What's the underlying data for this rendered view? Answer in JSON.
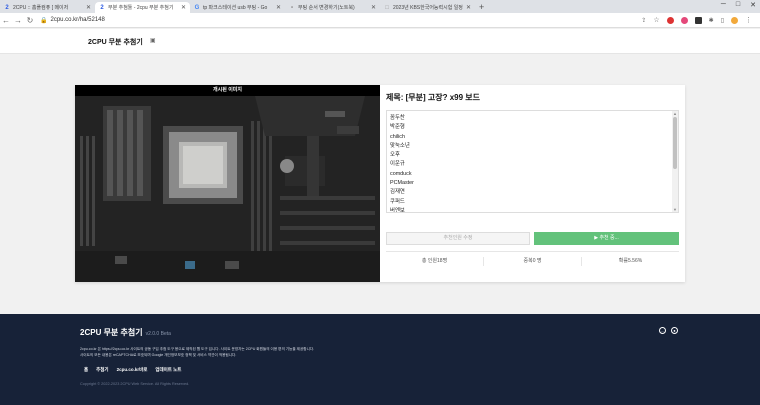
{
  "browser": {
    "tabs": [
      {
        "label": "2CPU :: 홈플컴퓨 [ 메이저",
        "favicon": "2",
        "favicon_color": "#2d5be3"
      },
      {
        "label": "무분 추첨툴 - 2cpu 무분 추첨기",
        "favicon": "2",
        "favicon_color": "#2d5be3"
      },
      {
        "label": "tp 파크스테이션 usb 부팅 - Go",
        "favicon": "G",
        "favicon_color": "#4285f4"
      },
      {
        "label": "부팅 순서 변경하기(노트북)",
        "favicon": "•",
        "favicon_color": "#999999"
      },
      {
        "label": "2023년 KBS한국어능력시험 일정",
        "favicon": "□",
        "favicon_color": "#999999"
      }
    ],
    "url": "2cpu.co.kr/ha/52148"
  },
  "site": {
    "brand": "2CPU 무분 추첨기"
  },
  "card": {
    "image_caption": "개시된 이미지",
    "title": "제목: [무분] 고장? x99 보드",
    "names": [
      "꼼두찬",
      "박준형",
      "chilich",
      "맞눅소년",
      "오후",
      "이운규",
      "comduck",
      "PCMaster",
      "김재연",
      "쿠퍼드",
      "버엔보"
    ],
    "btn_disabled": "추천인원 수정",
    "btn_go": "▶ 추천 중...",
    "stats": [
      "총 인원18명",
      "중복0 명",
      "확률5.56%"
    ]
  },
  "footer": {
    "title": "2CPU 무분 추첨기",
    "version": "v2.0.0 Beta",
    "desc1": "2cpu.co.kr 은 https://2cpu.co.kr 사이트의 공동 구입 추첨 도구 용으로 제작된 웹 도구 입니다. 사이트 운영자는 2CPU 회원들의 이용 편의 기능을 제공합니다.",
    "desc2": "사이트의 모든 내용은 reCAPTCHA로 보호되며 Google 개인정보보호 정책 및 서비스 약관이 적용됩니다.",
    "links": [
      "홈",
      "추첨기",
      "2cpu.co.kr바로",
      "업데이트 노트"
    ],
    "copyright": "Copyright © 2022-2023 2CPU Web Service. All Rights Reserved."
  }
}
